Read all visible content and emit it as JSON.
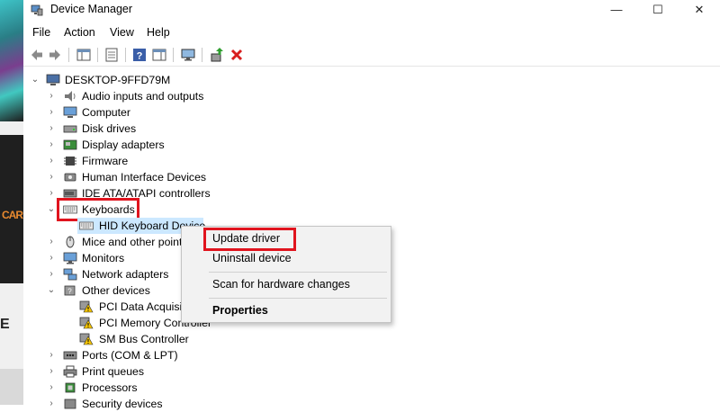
{
  "window": {
    "title": "Device Manager",
    "controls": {
      "minimize": "—",
      "maximize": "☐",
      "close": "✕"
    }
  },
  "menu": [
    "File",
    "Action",
    "View",
    "Help"
  ],
  "background_app": {
    "logo_fragment": "CAR",
    "letter_fragment": "E"
  },
  "tree": {
    "root": "DESKTOP-9FFD79M",
    "categories": [
      {
        "label": "Audio inputs and outputs",
        "icon": "speaker-icon",
        "expanded": false
      },
      {
        "label": "Computer",
        "icon": "computer-icon",
        "expanded": false
      },
      {
        "label": "Disk drives",
        "icon": "disk-icon",
        "expanded": false
      },
      {
        "label": "Display adapters",
        "icon": "display-adapter-icon",
        "expanded": false
      },
      {
        "label": "Firmware",
        "icon": "firmware-icon",
        "expanded": false
      },
      {
        "label": "Human Interface Devices",
        "icon": "hid-icon",
        "expanded": false
      },
      {
        "label": "IDE ATA/ATAPI controllers",
        "icon": "ide-icon",
        "expanded": false
      },
      {
        "label": "Keyboards",
        "icon": "keyboard-icon",
        "expanded": true,
        "children": [
          "HID Keyboard Device"
        ]
      },
      {
        "label": "Mice and other point",
        "icon": "mouse-icon",
        "expanded": false
      },
      {
        "label": "Monitors",
        "icon": "monitor-icon",
        "expanded": false
      },
      {
        "label": "Network adapters",
        "icon": "network-icon",
        "expanded": false
      },
      {
        "label": "Other devices",
        "icon": "other-devices-icon",
        "expanded": true,
        "children": [
          "PCI Data Acquisit",
          "PCI Memory Controller",
          "SM Bus Controller"
        ]
      },
      {
        "label": "Ports (COM & LPT)",
        "icon": "port-icon",
        "expanded": false
      },
      {
        "label": "Print queues",
        "icon": "printer-icon",
        "expanded": false
      },
      {
        "label": "Processors",
        "icon": "processor-icon",
        "expanded": false
      },
      {
        "label": "Security devices",
        "icon": "security-icon",
        "expanded": false
      }
    ]
  },
  "context_menu": {
    "items": [
      "Update driver",
      "Uninstall device",
      "Scan for hardware changes",
      "Properties"
    ]
  },
  "colors": {
    "highlight": "#e0141e",
    "selection": "#cce8ff"
  }
}
